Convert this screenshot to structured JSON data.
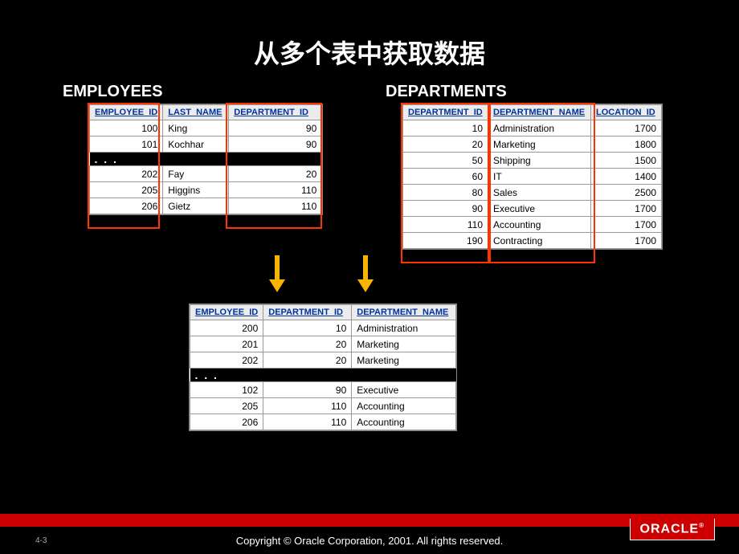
{
  "title": "从多个表中获取数据",
  "tables": {
    "employees": {
      "label": "EMPLOYEES",
      "headers": [
        "EMPLOYEE_ID",
        "LAST_NAME",
        "DEPARTMENT_ID"
      ],
      "rows1": [
        {
          "id": "100",
          "name": "King",
          "dept": "90"
        },
        {
          "id": "101",
          "name": "Kochhar",
          "dept": "90"
        }
      ],
      "ellipsis": ". . .",
      "rows2": [
        {
          "id": "202",
          "name": "Fay",
          "dept": "20"
        },
        {
          "id": "205",
          "name": "Higgins",
          "dept": "110"
        },
        {
          "id": "206",
          "name": "Gietz",
          "dept": "110"
        }
      ]
    },
    "departments": {
      "label": "DEPARTMENTS",
      "headers": [
        "DEPARTMENT_ID",
        "DEPARTMENT_NAME",
        "LOCATION_ID"
      ],
      "rows": [
        {
          "id": "10",
          "name": "Administration",
          "loc": "1700"
        },
        {
          "id": "20",
          "name": "Marketing",
          "loc": "1800"
        },
        {
          "id": "50",
          "name": "Shipping",
          "loc": "1500"
        },
        {
          "id": "60",
          "name": "IT",
          "loc": "1400"
        },
        {
          "id": "80",
          "name": "Sales",
          "loc": "2500"
        },
        {
          "id": "90",
          "name": "Executive",
          "loc": "1700"
        },
        {
          "id": "110",
          "name": "Accounting",
          "loc": "1700"
        },
        {
          "id": "190",
          "name": "Contracting",
          "loc": "1700"
        }
      ]
    },
    "result": {
      "headers": [
        "EMPLOYEE_ID",
        "DEPARTMENT_ID",
        "DEPARTMENT_NAME"
      ],
      "rows1": [
        {
          "emp": "200",
          "dept": "10",
          "name": "Administration"
        },
        {
          "emp": "201",
          "dept": "20",
          "name": "Marketing"
        },
        {
          "emp": "202",
          "dept": "20",
          "name": "Marketing"
        }
      ],
      "ellipsis": ". . .",
      "rows2": [
        {
          "emp": "102",
          "dept": "90",
          "name": "Executive"
        },
        {
          "emp": "205",
          "dept": "110",
          "name": "Accounting"
        },
        {
          "emp": "206",
          "dept": "110",
          "name": "Accounting"
        }
      ]
    }
  },
  "footer": {
    "page": "4-3",
    "copyright": "Copyright © Oracle Corporation, 2001. All rights reserved.",
    "logo": "ORACLE"
  }
}
